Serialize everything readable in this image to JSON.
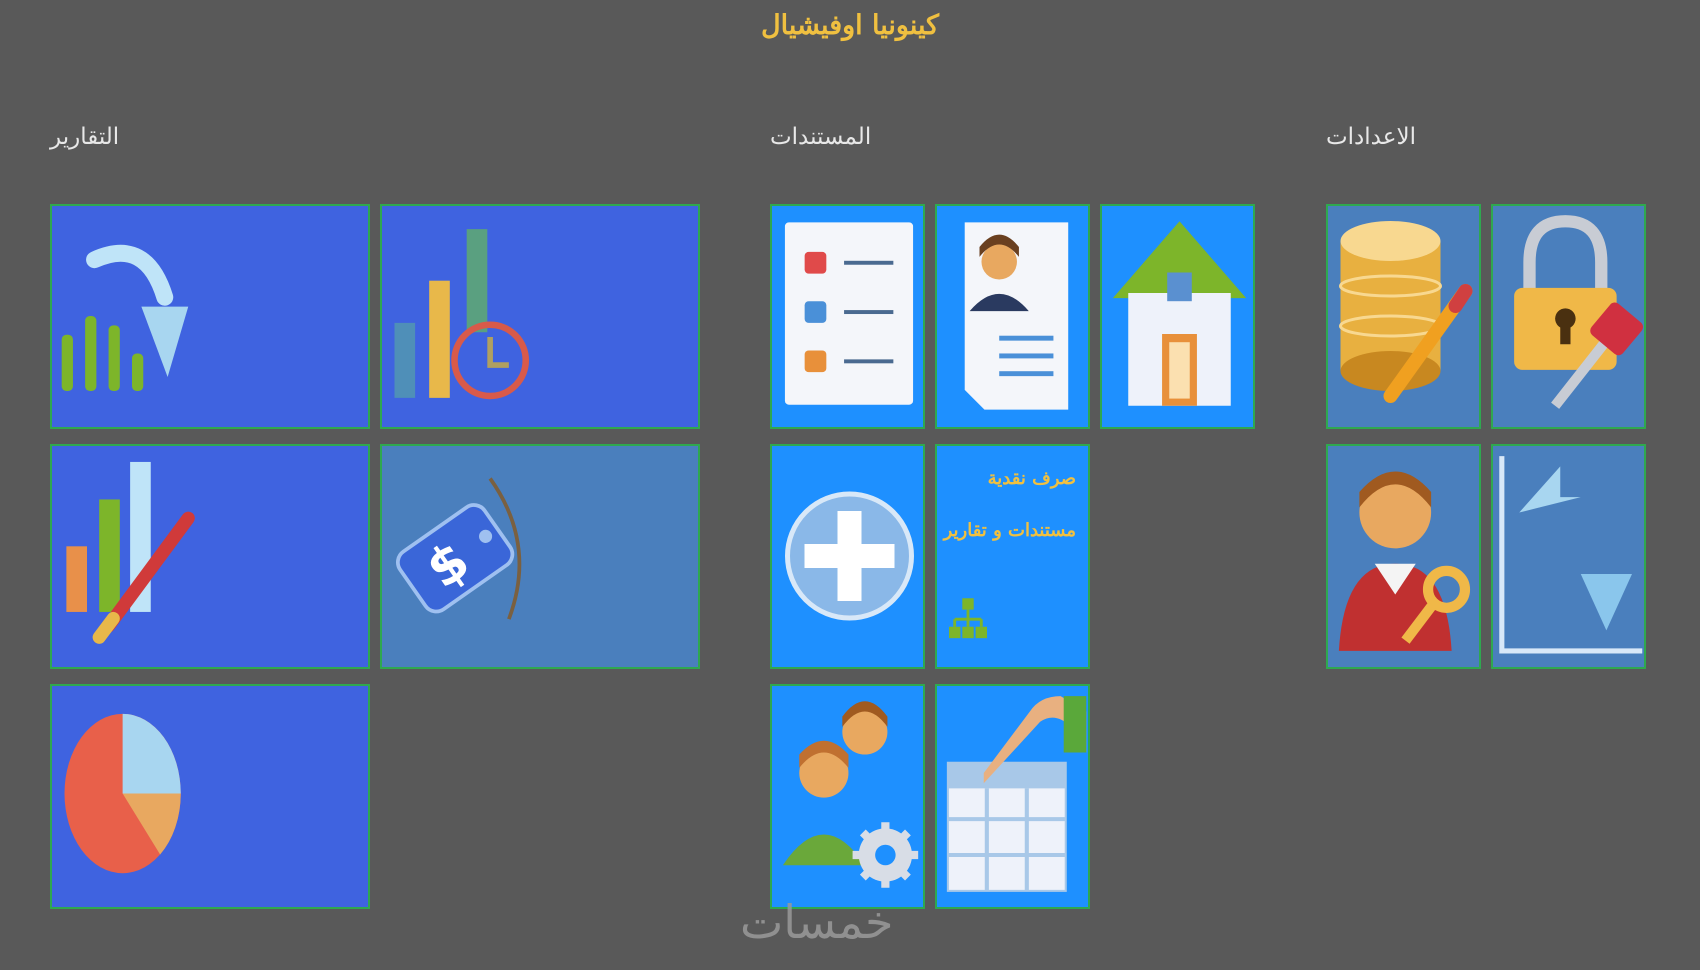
{
  "app": {
    "title": "كينونيا اوفيشيال"
  },
  "sections": {
    "reports": {
      "title": "التقارير"
    },
    "documents": {
      "title": "المستندات"
    },
    "settings": {
      "title": "الاعدادات"
    }
  },
  "documents": {
    "cash_tile": {
      "line1": "صرف نقدية",
      "line2": "مستندات و تقارير"
    }
  },
  "watermark": {
    "text": "خمسات"
  },
  "colors": {
    "background": "#595959",
    "tile_blue": "#3f63e0",
    "tile_steel": "#4a7fbd",
    "tile_azure": "#1e90ff",
    "tile_border": "#2fa84f",
    "title_gold": "#f0c040"
  },
  "icons": {
    "reports": [
      "chart-refresh-icon",
      "chart-clock-icon",
      "chart-edit-icon",
      "price-tag-icon",
      "pie-chart-icon"
    ],
    "documents": [
      "checklist-icon",
      "resume-icon",
      "home-icon",
      "add-circle-icon",
      "org-chart-icon",
      "users-settings-icon",
      "table-pointer-icon"
    ],
    "settings": [
      "database-edit-icon",
      "lock-key-icon",
      "user-key-icon",
      "undo-arrow-icon"
    ]
  }
}
